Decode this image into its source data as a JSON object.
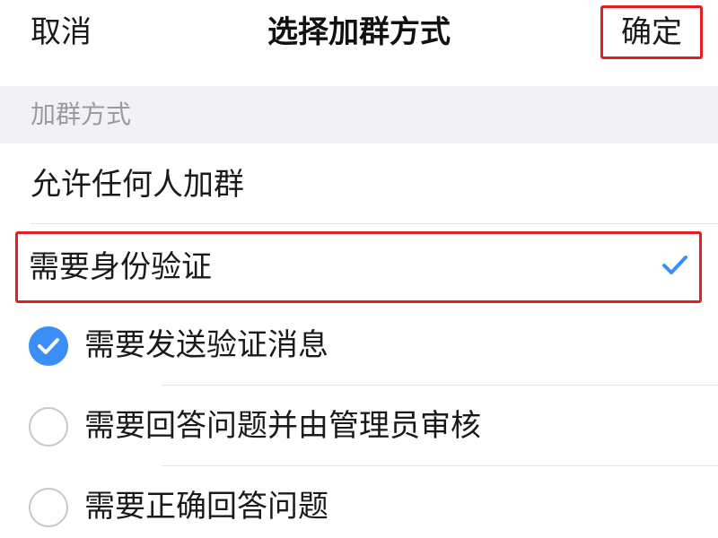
{
  "header": {
    "cancel_label": "取消",
    "title": "选择加群方式",
    "confirm_label": "确定"
  },
  "section": {
    "title": "加群方式"
  },
  "options": {
    "any": {
      "label": "允许任何人加群",
      "selected": false
    },
    "verify": {
      "label": "需要身份验证",
      "selected": true
    }
  },
  "sub_options": [
    {
      "label": "需要发送验证消息",
      "checked": true
    },
    {
      "label": "需要回答问题并由管理员审核",
      "checked": false
    },
    {
      "label": "需要正确回答问题",
      "checked": false
    }
  ],
  "colors": {
    "accent": "#3a8ef5",
    "highlight_border": "#e02020",
    "section_bg": "#f2f2f6",
    "section_text": "#9a9aa0"
  },
  "icons": {
    "selected_check": "check-icon",
    "radio_checked": "radio-checked-icon",
    "radio_unchecked": "radio-unchecked-icon"
  }
}
